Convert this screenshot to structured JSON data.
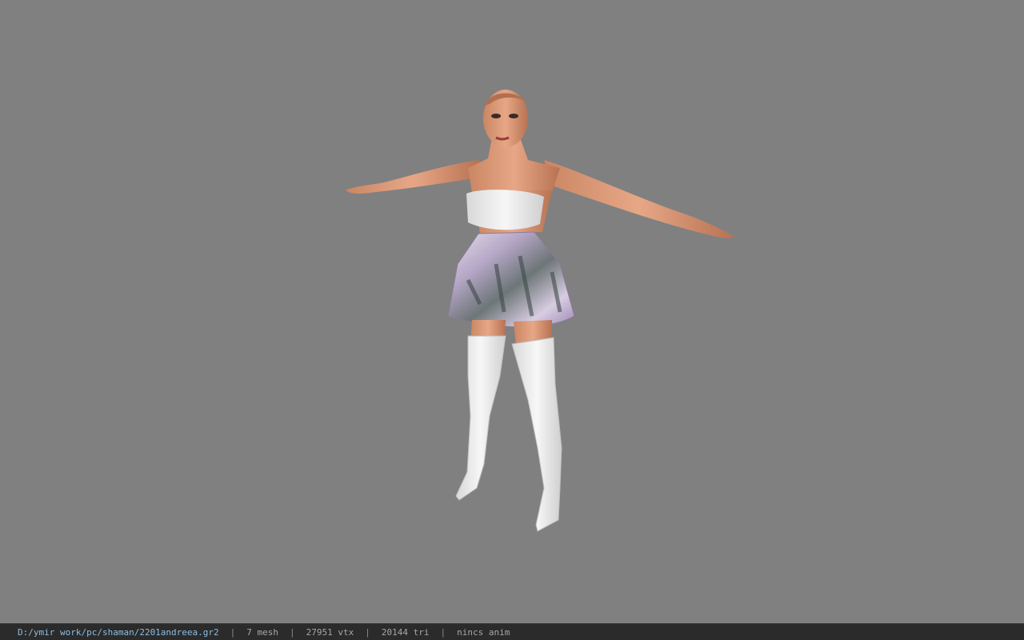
{
  "viewer": {
    "background_color": "#808080",
    "model_icon": "character-model-icon"
  },
  "status": {
    "path": "D:/ymir work/pc/shaman/2201andreea.gr2",
    "sep": "|",
    "mesh": "7 mesh",
    "vtx": "27951 vtx",
    "tri": "20144 tri",
    "anim": "nincs anim"
  }
}
